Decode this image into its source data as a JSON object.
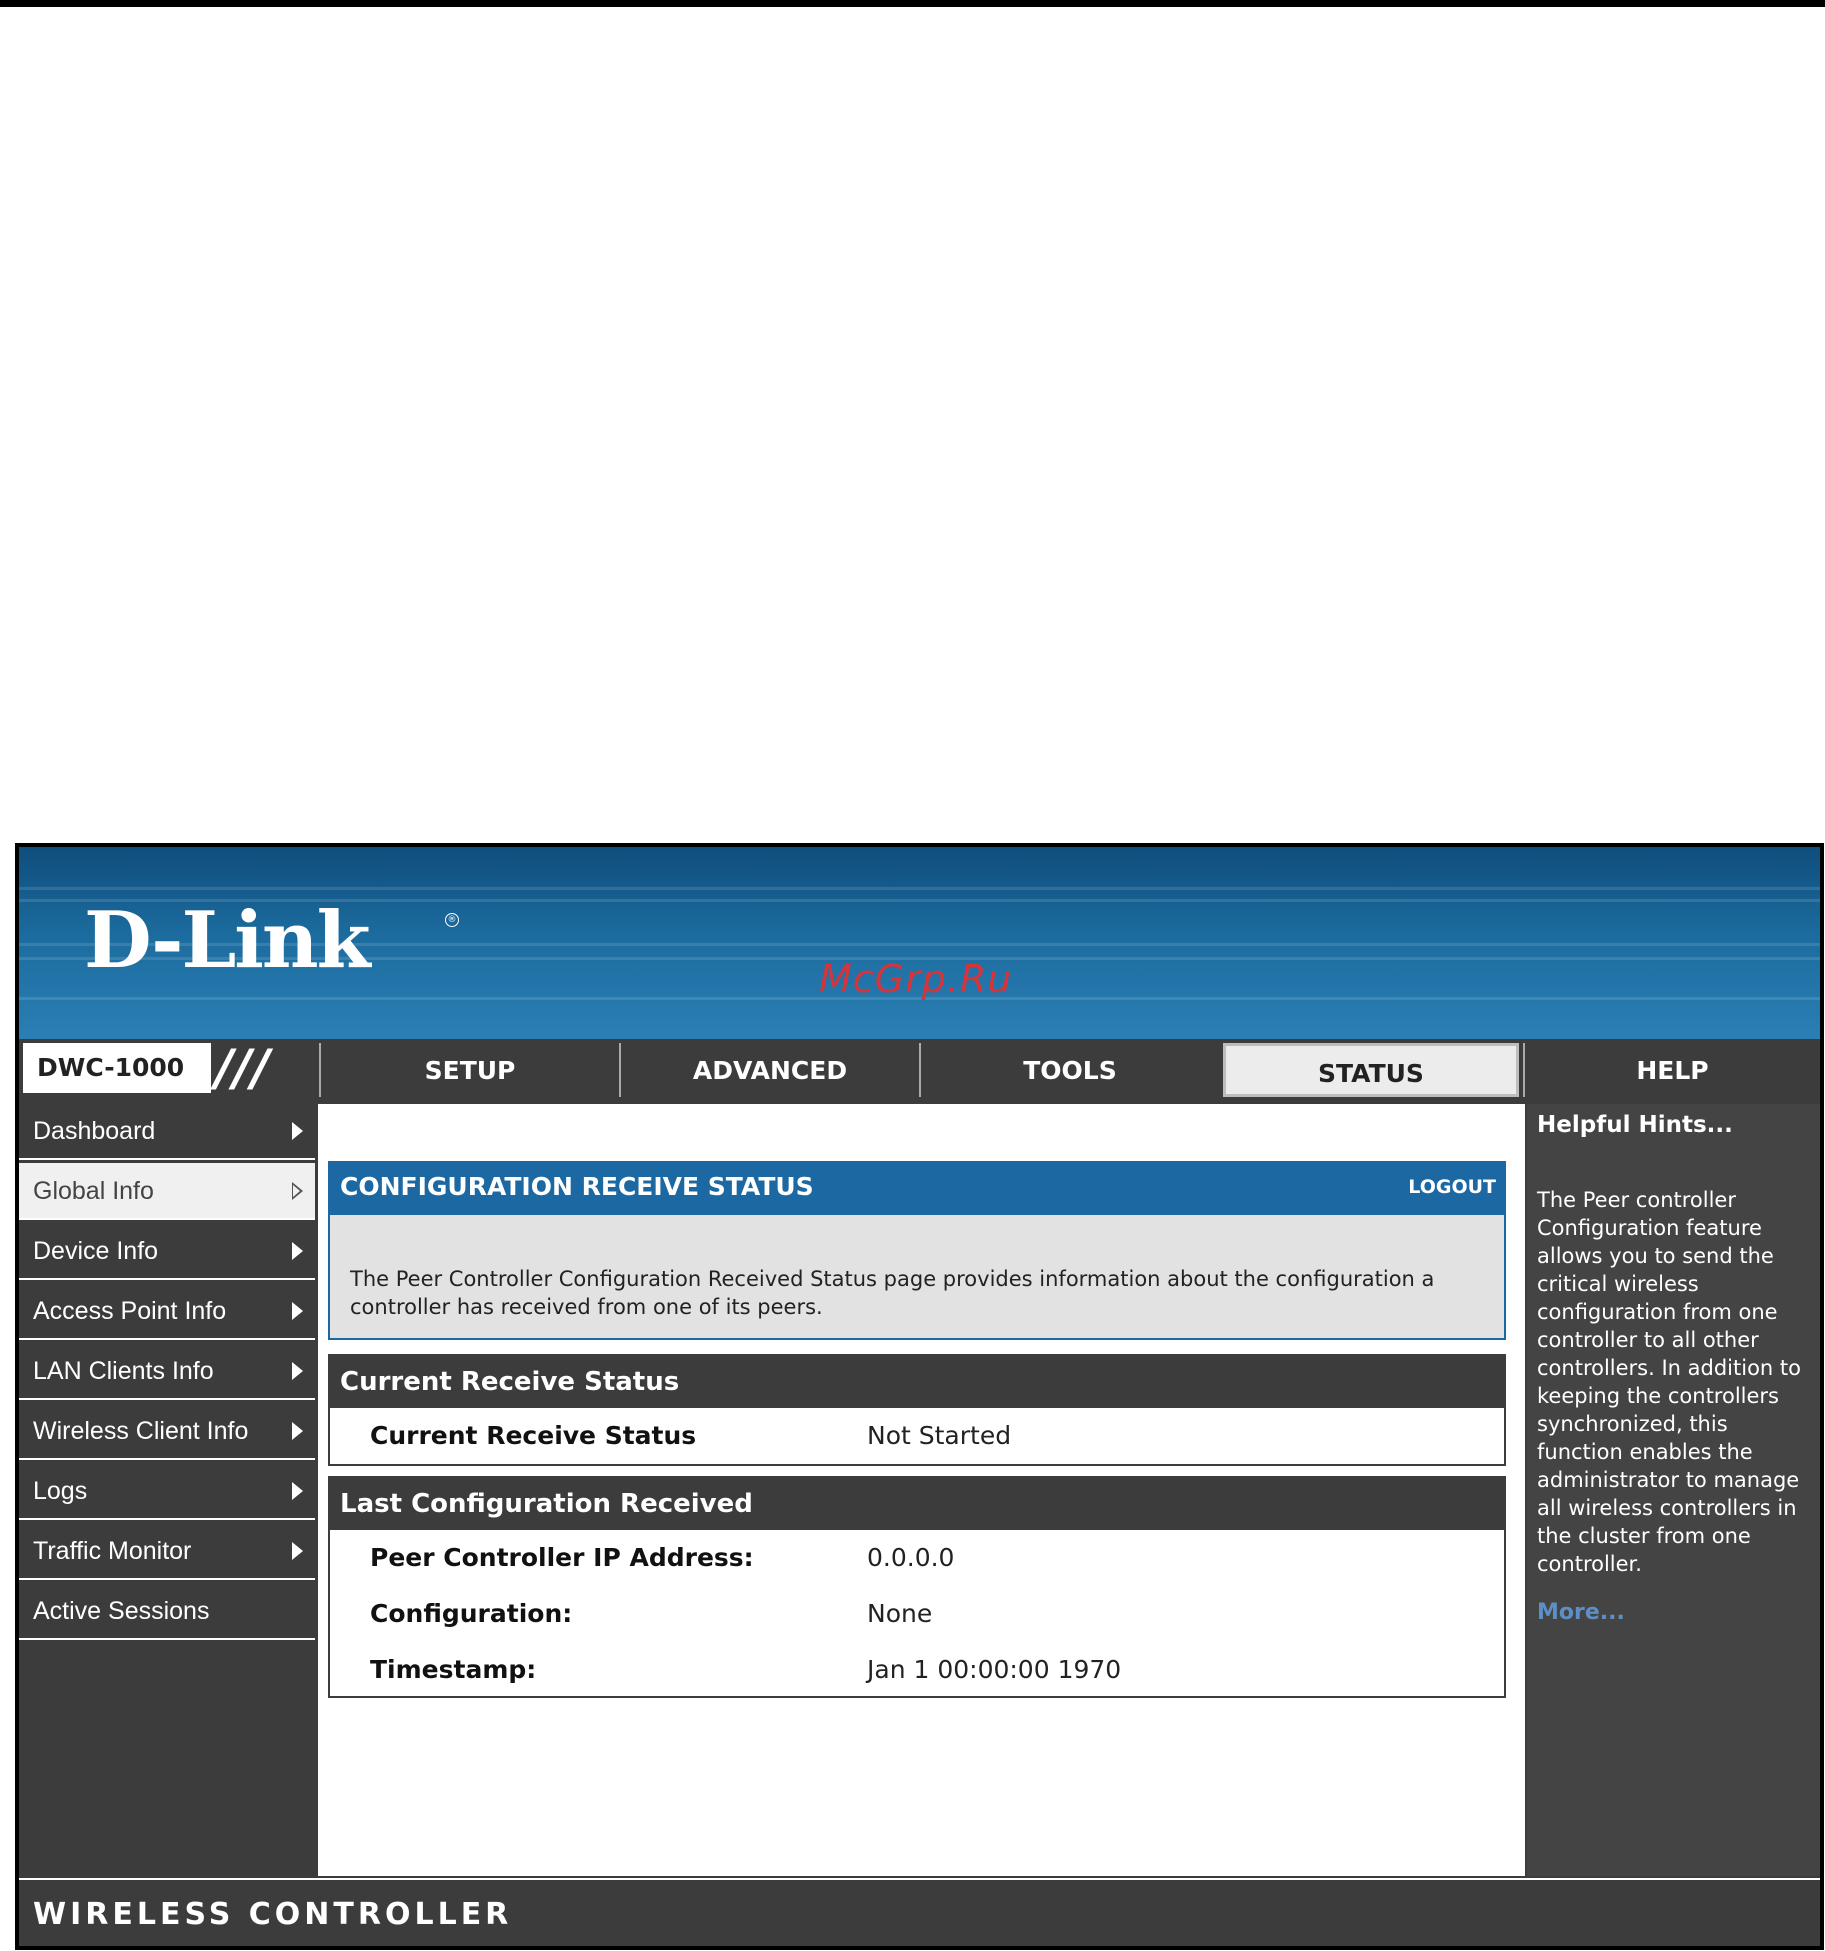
{
  "brand": {
    "logo_text": "D-Link",
    "registered_mark": "®",
    "watermark": "McGrp.Ru"
  },
  "nav": {
    "model": "DWC-1000",
    "slashes": "///",
    "tabs": [
      {
        "label": "SETUP",
        "active": false
      },
      {
        "label": "ADVANCED",
        "active": false
      },
      {
        "label": "TOOLS",
        "active": false
      },
      {
        "label": "STATUS",
        "active": true
      },
      {
        "label": "HELP",
        "active": false
      }
    ]
  },
  "sidebar": {
    "items": [
      {
        "label": "Dashboard",
        "active": false,
        "arrow": "filled"
      },
      {
        "label": "Global Info",
        "active": true,
        "arrow": "hollow"
      },
      {
        "label": "Device Info",
        "active": false,
        "arrow": "filled"
      },
      {
        "label": "Access Point Info",
        "active": false,
        "arrow": "filled"
      },
      {
        "label": "LAN Clients Info",
        "active": false,
        "arrow": "filled"
      },
      {
        "label": "Wireless Client Info",
        "active": false,
        "arrow": "filled"
      },
      {
        "label": "Logs",
        "active": false,
        "arrow": "filled"
      },
      {
        "label": "Traffic Monitor",
        "active": false,
        "arrow": "filled"
      },
      {
        "label": "Active Sessions",
        "active": false,
        "arrow": "none"
      }
    ]
  },
  "main": {
    "title": "CONFIGURATION RECEIVE STATUS",
    "logout": "LOGOUT",
    "description": "The Peer Controller Configuration Received Status page provides information about the configuration a controller has received from one of its peers.",
    "current_status": {
      "heading": "Current Receive Status",
      "rows": [
        {
          "label": "Current Receive Status",
          "value": "Not Started"
        }
      ]
    },
    "last_config": {
      "heading": "Last Configuration Received",
      "rows": [
        {
          "label": "Peer Controller IP Address:",
          "value": "0.0.0.0"
        },
        {
          "label": "Configuration:",
          "value": "None"
        },
        {
          "label": "Timestamp:",
          "value": "Jan 1 00:00:00 1970"
        }
      ]
    }
  },
  "help": {
    "title": "Helpful Hints...",
    "text": "The Peer controller Configuration feature allows you to send the critical wireless configuration from one controller to all other controllers. In addition to keeping the controllers synchronized, this function enables the administrator to manage all wireless controllers in the cluster from one controller.",
    "more": "More..."
  },
  "footer": {
    "label": "WIRELESS CONTROLLER"
  },
  "colors": {
    "header_blue": "#1c68a2",
    "dark_gray": "#3c3c3c",
    "link_blue": "#5d8fc6",
    "watermark_red": "#d6343a"
  }
}
